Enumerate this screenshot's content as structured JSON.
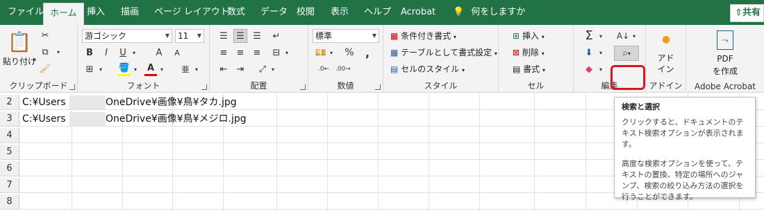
{
  "tabs": [
    "ファイル",
    "ホーム",
    "挿入",
    "描画",
    "ページ レイアウト",
    "数式",
    "データ",
    "校閲",
    "表示",
    "ヘルプ",
    "Acrobat"
  ],
  "tell_me": "何をしますか",
  "share": "共有",
  "ribbon": {
    "clipboard": {
      "label": "クリップボード",
      "paste": "貼り付け"
    },
    "font": {
      "label": "フォント",
      "name": "游ゴシック",
      "size": "11",
      "bold": "B",
      "italic": "I",
      "underline": "U",
      "grow": "A",
      "shrink": "A"
    },
    "align": {
      "label": "配置"
    },
    "number": {
      "label": "数値",
      "format": "標準",
      "percent": "%",
      "comma": ","
    },
    "styles": {
      "label": "スタイル",
      "conditional": "条件付き書式",
      "table": "テーブルとして書式設定",
      "cell": "セルのスタイル"
    },
    "cells": {
      "label": "セル",
      "insert": "挿入",
      "delete": "削除",
      "format": "書式"
    },
    "editing": {
      "label": "編集",
      "sum": "Σ"
    },
    "addins": {
      "label": "アドイン",
      "btn": "アド\nイン"
    },
    "acrobat": {
      "label": "Adobe Acrobat",
      "btn1": "PDF",
      "btn2": "を作成"
    }
  },
  "rows": [
    {
      "num": "2",
      "prefix": "C:¥Users",
      "suffix": "OneDrive¥画像¥鳥¥タカ.jpg"
    },
    {
      "num": "3",
      "prefix": "C:¥Users",
      "suffix": "OneDrive¥画像¥鳥¥メジロ.jpg"
    },
    {
      "num": "4",
      "prefix": "",
      "suffix": ""
    },
    {
      "num": "5",
      "prefix": "",
      "suffix": ""
    },
    {
      "num": "6",
      "prefix": "",
      "suffix": ""
    },
    {
      "num": "7",
      "prefix": "",
      "suffix": ""
    },
    {
      "num": "8",
      "prefix": "",
      "suffix": ""
    }
  ],
  "tooltip": {
    "title": "検索と選択",
    "p1": "クリックすると、ドキュメントのテキスト検索オプションが表示されます。",
    "p2": "高度な検索オプションを使って、テキストの置換、特定の場所へのジャンプ、検索の絞り込み方法の選択を行うことができます。"
  }
}
